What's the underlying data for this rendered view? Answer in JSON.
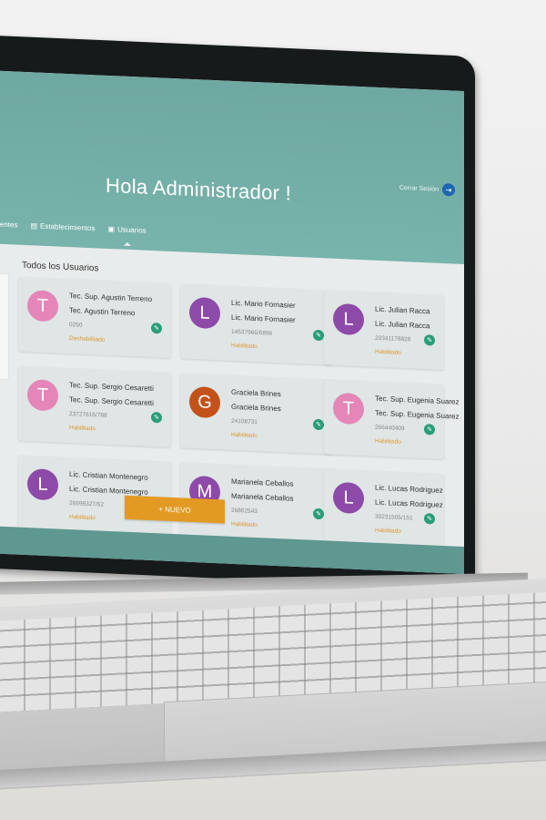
{
  "header": {
    "title": "Hola Administrador !",
    "logout_label": "Cerrar Sesión"
  },
  "nav": {
    "items": [
      {
        "label": "Clientes",
        "icon": "building-icon"
      },
      {
        "label": "Establecimientos",
        "icon": "store-icon"
      },
      {
        "label": "Usuarios",
        "icon": "id-card-icon",
        "active": true
      }
    ]
  },
  "main": {
    "section_title": "Todos los Usuarios",
    "new_button": "+ NUEVO"
  },
  "users": [
    {
      "initial": "T",
      "color": "#e486b8",
      "name1": "Tec. Sup. Agustin Terreno",
      "name2": "Tec. Agustin Terreno",
      "doc": "0250",
      "status": "Deshabilitado"
    },
    {
      "initial": "L",
      "color": "#8e4aa8",
      "name1": "Lic. Mario Fornasier",
      "name2": "Lic. Mario Fornasier",
      "doc": "14537966/6896",
      "status": "Habilitado"
    },
    {
      "initial": "L",
      "color": "#8e4aa8",
      "name1": "Lic. Julian Racca",
      "name2": "Lic. Julian Racca",
      "doc": "20341178828",
      "status": "Habilitado"
    },
    {
      "initial": "T",
      "color": "#e486b8",
      "name1": "Tec. Sup. Sergio Cesaretti",
      "name2": "Tec. Sup. Sergio Cesaretti",
      "doc": "23727616/788",
      "status": "Habilitado"
    },
    {
      "initial": "G",
      "color": "#c3521a",
      "name1": "Graciela Brines",
      "name2": "Graciela Brines",
      "doc": "24108731",
      "status": "Habilitado"
    },
    {
      "initial": "T",
      "color": "#e486b8",
      "name1": "Tec. Sup. Eugenia Suarez",
      "name2": "Tec. Sup. Eugenia Suarez",
      "doc": "266440409",
      "status": "Habilitado"
    },
    {
      "initial": "L",
      "color": "#8e4aa8",
      "name1": "Lic. Cristian Montenegro",
      "name2": "Lic. Cristian Montenegro",
      "doc": "26698327/52",
      "status": "Habilitado"
    },
    {
      "initial": "M",
      "color": "#8e4aa8",
      "name1": "Marianela Ceballos",
      "name2": "Marianela Ceballos",
      "doc": "26862543",
      "status": "Habilitado"
    },
    {
      "initial": "L",
      "color": "#8e4aa8",
      "name1": "Lic. Lucas Rodriguez",
      "name2": "Lic. Lucas Rodriguez",
      "doc": "30231505/151",
      "status": "Habilitado"
    }
  ]
}
